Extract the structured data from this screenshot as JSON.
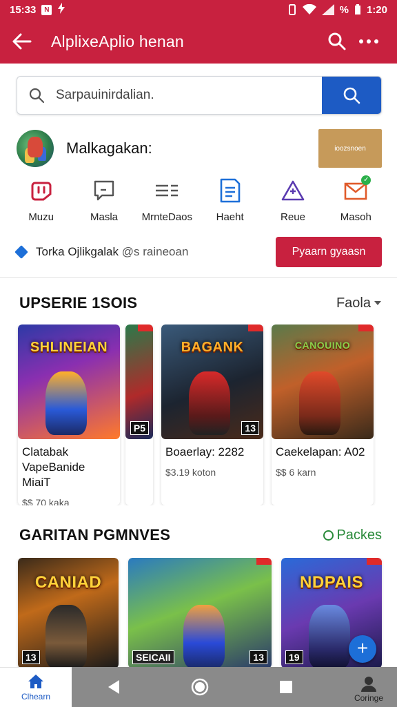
{
  "status_bar": {
    "time_left": "15:33",
    "badge_label": "N",
    "battery_text": "%",
    "time_right": "1:20"
  },
  "app_bar": {
    "title": "AlplixeAplio henan",
    "back_icon": "arrow-left-icon",
    "search_icon": "search-icon",
    "more_icon": "more-horizontal-icon"
  },
  "search": {
    "placeholder": "Sarpauinirdalian.",
    "value": ""
  },
  "profile": {
    "name": "Malkagakan:",
    "promo_label": "ioozsnoen"
  },
  "quick_actions": [
    {
      "label": "Muzu",
      "icon": "gamepad-icon",
      "color": "#c8213f"
    },
    {
      "label": "Masla",
      "icon": "message-icon",
      "color": "#555555"
    },
    {
      "label": "MrnteDaos",
      "icon": "list-icon",
      "color": "#555555"
    },
    {
      "label": "Haeht",
      "icon": "document-icon",
      "color": "#1d6fd8"
    },
    {
      "label": "Reue",
      "icon": "triangle-icon",
      "color": "#5a3ab0"
    },
    {
      "label": "Masoh",
      "icon": "mail-icon",
      "color": "#e05a2a"
    }
  ],
  "info": {
    "prefix": "Torka",
    "text": "Ojlikgalak",
    "muted": "@s raineoan",
    "button_label": "Pyaarn gyaasn"
  },
  "section1": {
    "title": "UPSERIE 1SOIS",
    "link": "Faola",
    "cards": [
      {
        "logo": "SHLINEIAN",
        "tag": "P5",
        "title": "Clatabak VapeBanide MiaiT",
        "price": "$$ 70 kaka"
      },
      {
        "logo": "BAGANK",
        "tag": "13",
        "title": "Boaerlay: 2282",
        "price": "$3.19 koton"
      },
      {
        "logo": "CANOUINO",
        "tag": "",
        "title": "Caekelapan: A02",
        "price": "$$ 6 karn"
      }
    ]
  },
  "section2": {
    "title": "GARITAN PGMNVES",
    "link": "Packes",
    "cards": [
      {
        "logo": "CANIAD",
        "tag": "13"
      },
      {
        "logo": "",
        "tag": "SEICAII",
        "tag2": "13"
      },
      {
        "logo": "NDPAIS",
        "tag": "19"
      }
    ]
  },
  "bottom_nav": {
    "home_label": "Clhearn",
    "profile_label": "Coringe"
  },
  "colors": {
    "brand_red": "#c8213f",
    "brand_blue": "#1d5bc4"
  }
}
